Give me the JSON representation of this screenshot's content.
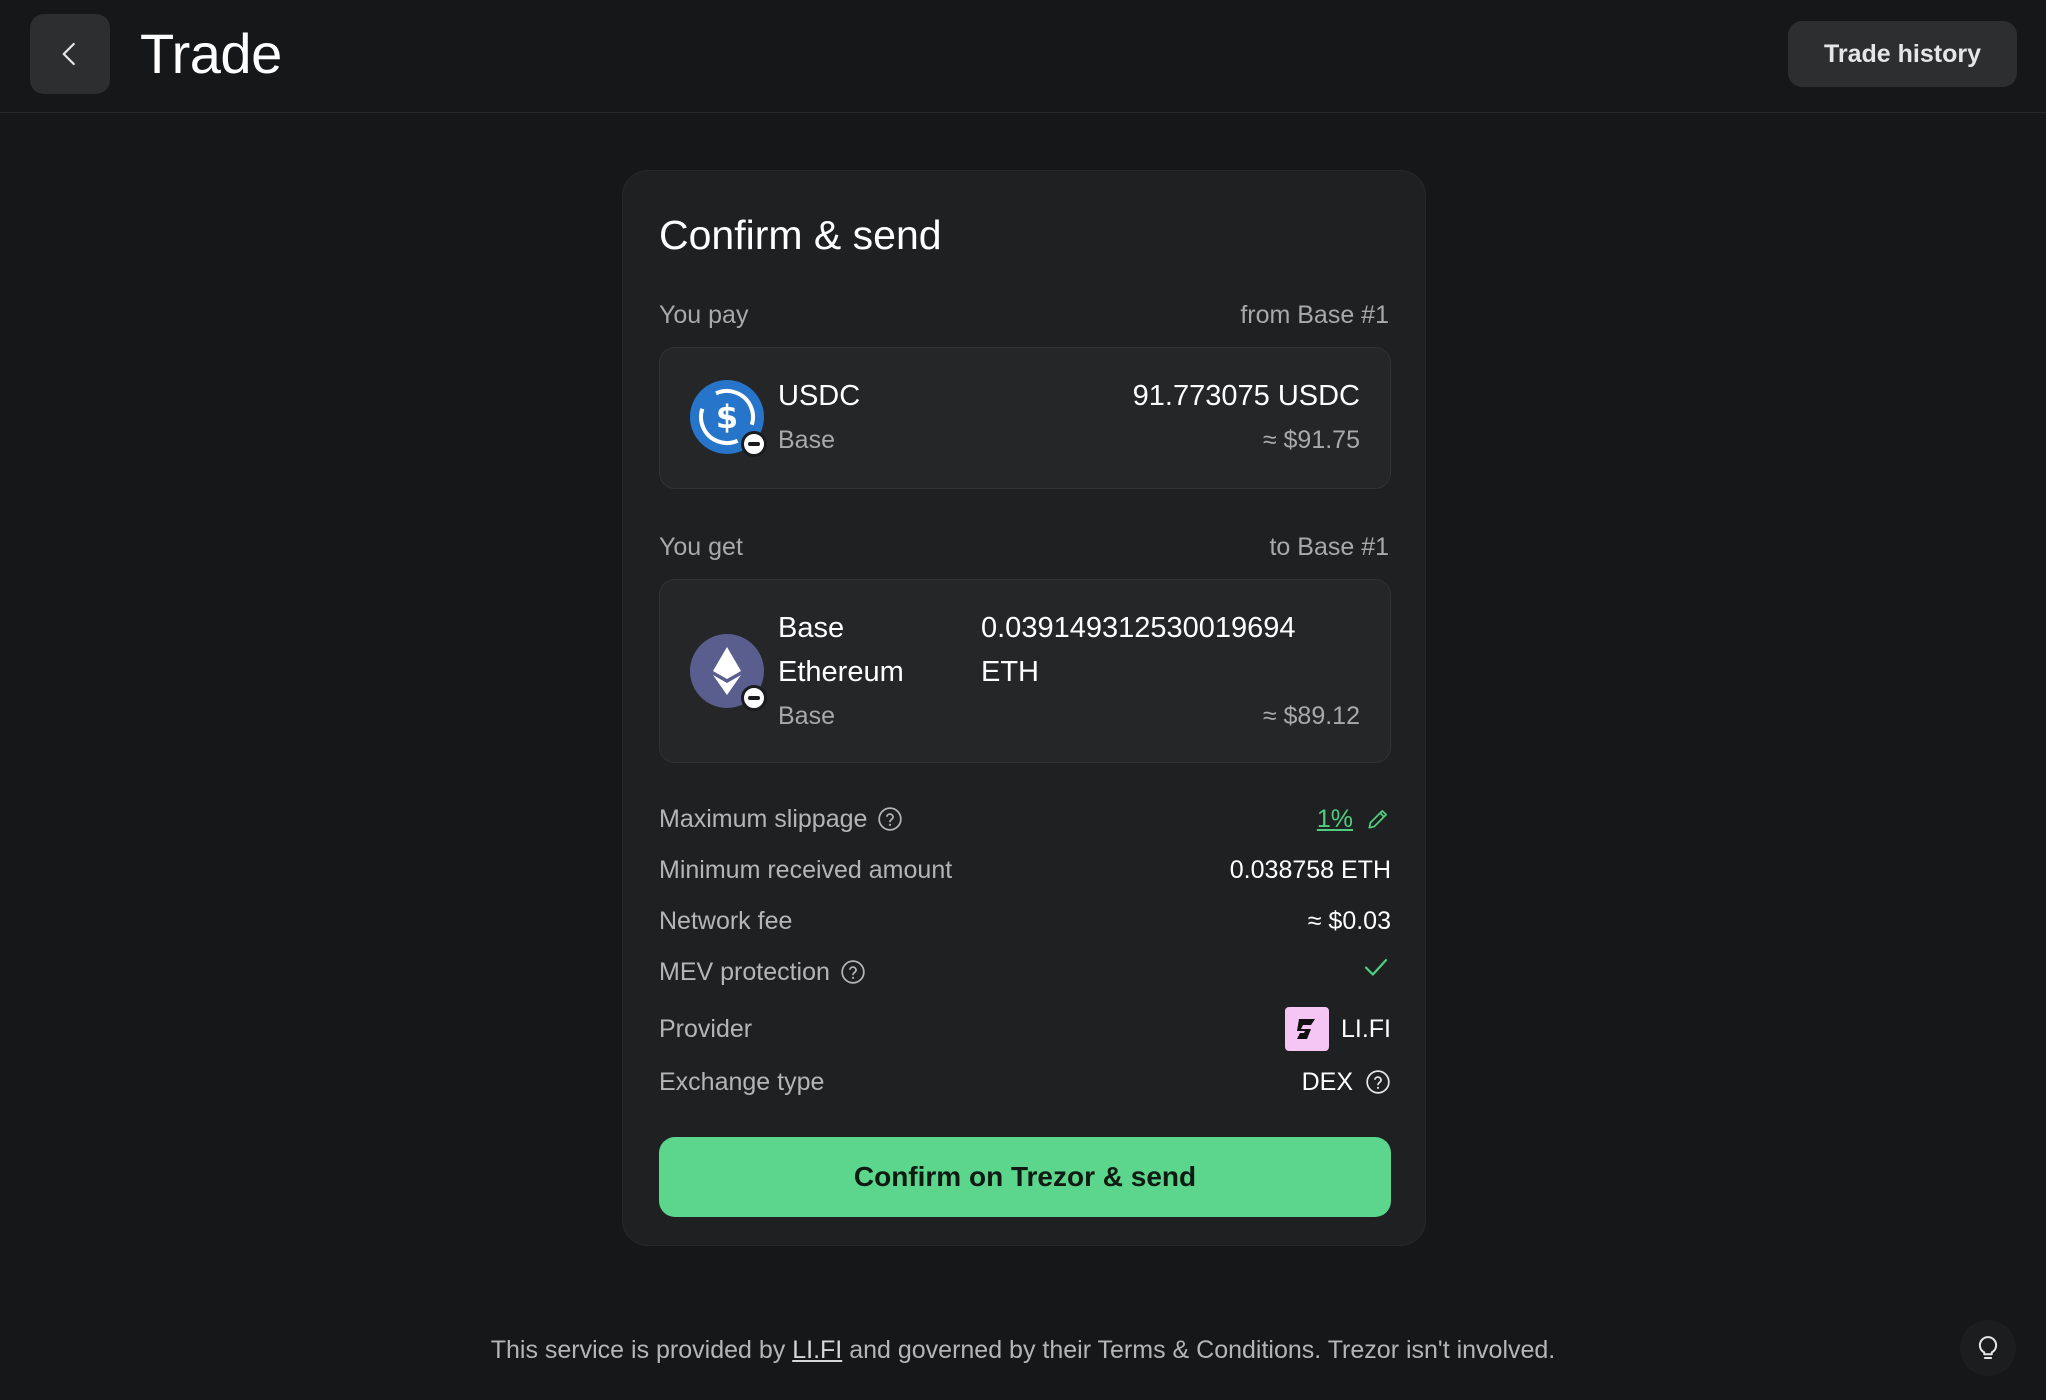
{
  "header": {
    "title": "Trade",
    "history_label": "Trade history"
  },
  "card": {
    "title": "Confirm & send",
    "pay": {
      "label": "You pay",
      "source": "from Base #1",
      "asset_name": "USDC",
      "network": "Base",
      "amount": "91.773075 USDC",
      "fiat": "≈ $91.75",
      "icon": "usdc-coin-icon"
    },
    "get": {
      "label": "You get",
      "destination": "to Base #1",
      "asset_name_line1": "Base",
      "asset_name_line2": "Ethereum",
      "network": "Base",
      "amount_line1": "0.039149312530019694",
      "amount_line2": "ETH",
      "fiat": "≈ $89.12",
      "icon": "eth-coin-icon"
    },
    "details": {
      "slippage_label": "Maximum slippage",
      "slippage_value": "1%",
      "min_received_label": "Minimum received amount",
      "min_received_value": "0.038758 ETH",
      "network_fee_label": "Network fee",
      "network_fee_value": "≈ $0.03",
      "mev_label": "MEV protection",
      "provider_label": "Provider",
      "provider_value": "LI.FI",
      "exchange_type_label": "Exchange type",
      "exchange_type_value": "DEX"
    },
    "confirm_label": "Confirm on Trezor & send"
  },
  "footer": {
    "text_before": "This service is provided by ",
    "link": "LI.FI",
    "text_after": " and governed by their Terms & Conditions. Trezor isn't involved."
  },
  "colors": {
    "background": "#161718",
    "card": "#1f2022",
    "accent_green": "#5bd68c",
    "link_green": "#4fce7f",
    "usdc_blue": "#2775ca",
    "eth_purple": "#5a5e8e"
  }
}
